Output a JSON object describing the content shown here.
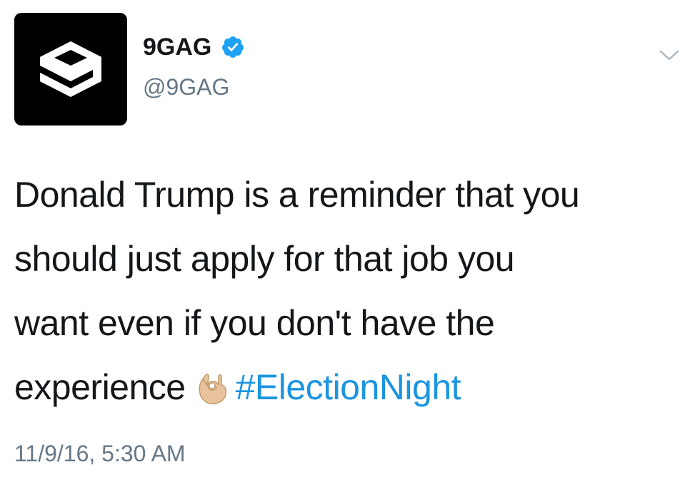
{
  "account": {
    "display_name": "9GAG",
    "handle": "@9GAG",
    "verified": true,
    "avatar_icon": "9gag-logo-icon"
  },
  "menu": {
    "icon": "chevron-down-icon"
  },
  "tweet": {
    "lines": [
      "Donald Trump is a reminder that you",
      "should just apply for that job you",
      "want even if you don't have the",
      "experience"
    ],
    "emoji": "ok-hand-emoji",
    "hashtag": "#ElectionNight",
    "timestamp": "11/9/16, 5:30 AM"
  },
  "colors": {
    "text": "#14171a",
    "secondary": "#657786",
    "link": "#1b95e0",
    "verified": "#1da1f2"
  }
}
